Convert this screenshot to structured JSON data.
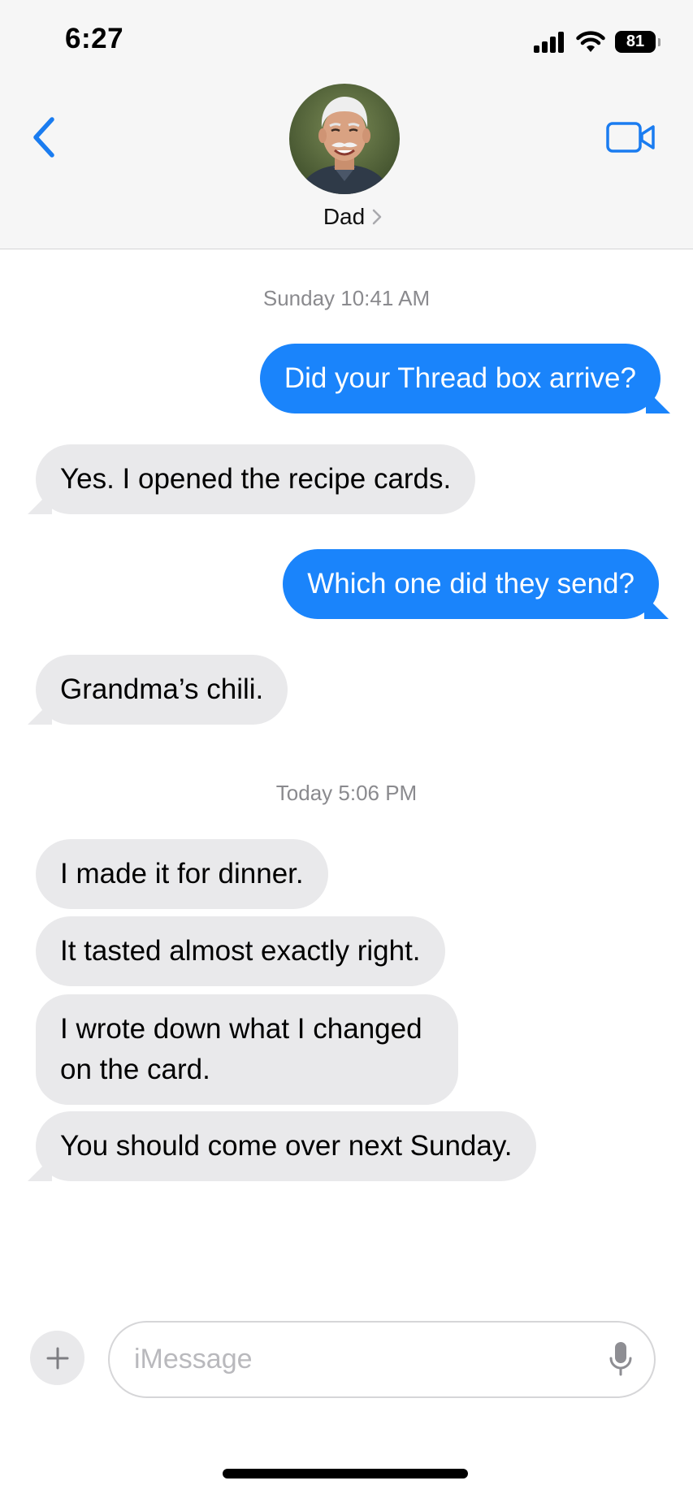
{
  "status_bar": {
    "time": "6:27",
    "battery": "81"
  },
  "header": {
    "contact_name": "Dad"
  },
  "messages": [
    {
      "timestamp": "Sunday 10:41 AM"
    },
    {
      "sent": "Did your Thread box arrive?"
    },
    {
      "received": "Yes. I opened the recipe cards."
    },
    {
      "sent": "Which one did they send?"
    },
    {
      "received": "Grandma’s chili."
    },
    {
      "timestamp": "Today 5:06 PM"
    },
    {
      "received": "I made it for dinner."
    },
    {
      "received": "It tasted almost exactly right."
    },
    {
      "received": "I wrote down what I changed on the card."
    },
    {
      "received": "You should come over next Sunday."
    }
  ],
  "composer": {
    "placeholder": "iMessage"
  },
  "colors": {
    "sent_bubble": "#1a84fb",
    "received_bubble": "#e9e9eb",
    "accent": "#1a7cf0"
  }
}
